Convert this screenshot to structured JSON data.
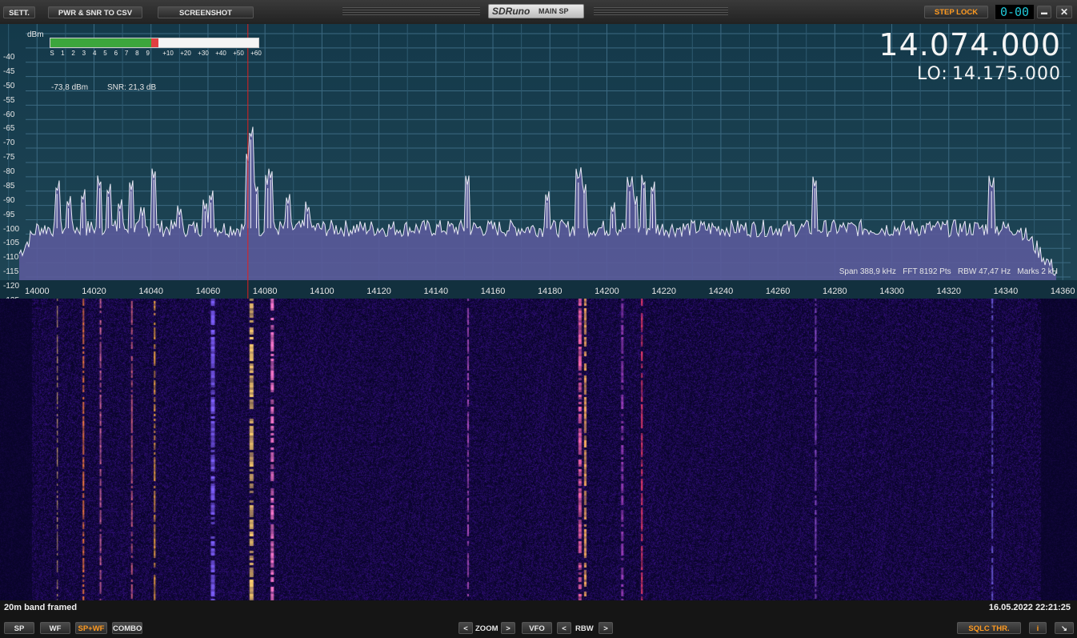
{
  "title_bar": {
    "sett_label": "SETT.",
    "pwr_snr_label": "PWR & SNR TO CSV",
    "screenshot_label": "SCREENSHOT",
    "logo_text": "SDRuno",
    "logo_sub": "MAIN SP",
    "step_lock_label": "STEP LOCK",
    "channel_display": "0-00",
    "minimize_glyph": "▬",
    "close_glyph": "✕"
  },
  "spectrum": {
    "dbm_unit": "dBm",
    "smeter_labels": [
      "S",
      "1",
      "2",
      "3",
      "4",
      "5",
      "6",
      "7",
      "8",
      "9",
      "+10",
      "+20",
      "+30",
      "+40",
      "+50",
      "+60"
    ],
    "smeter_fill_fraction": 0.52,
    "power_reading": "-73,8 dBm",
    "snr_reading": "SNR: 21,3 dB",
    "frequency": "14.074.000",
    "lo_label": "LO:",
    "lo_frequency": "14.175.000",
    "info_line": "Span 388,9 kHz   FFT 8192 Pts   RBW 47,47 Hz   Marks 2 kH"
  },
  "chart_data": {
    "type": "line",
    "xlim": [
      13987,
      14365
    ],
    "ylim": [
      -125,
      -40
    ],
    "yticks": [
      "-40",
      "-45",
      "-50",
      "-55",
      "-60",
      "-65",
      "-70",
      "-75",
      "-80",
      "-85",
      "-90",
      "-95",
      "-100",
      "-105",
      "-110",
      "-115",
      "-120",
      "-125"
    ],
    "xticks": [
      "14000",
      "14020",
      "14040",
      "14060",
      "14080",
      "14100",
      "14120",
      "14140",
      "14160",
      "14180",
      "14200",
      "14220",
      "14240",
      "14260",
      "14280",
      "14300",
      "14320",
      "14340",
      "14360"
    ],
    "noise_floor": -108,
    "tuned_marker": 14074,
    "peaks": [
      {
        "x": 14007,
        "y": -96
      },
      {
        "x": 14011,
        "y": -101
      },
      {
        "x": 14016,
        "y": -99
      },
      {
        "x": 14022,
        "y": -94
      },
      {
        "x": 14025,
        "y": -97
      },
      {
        "x": 14029,
        "y": -102
      },
      {
        "x": 14033,
        "y": -95
      },
      {
        "x": 14037,
        "y": -104
      },
      {
        "x": 14041,
        "y": -91
      },
      {
        "x": 14050,
        "y": -104
      },
      {
        "x": 14059,
        "y": -102
      },
      {
        "x": 14061,
        "y": -99
      },
      {
        "x": 14074,
        "y": -85
      },
      {
        "x": 14075,
        "y": -77
      },
      {
        "x": 14077,
        "y": -96
      },
      {
        "x": 14081,
        "y": -94
      },
      {
        "x": 14082,
        "y": -91
      },
      {
        "x": 14088,
        "y": -100
      },
      {
        "x": 14095,
        "y": -103
      },
      {
        "x": 14151,
        "y": -93
      },
      {
        "x": 14179,
        "y": -99
      },
      {
        "x": 14190,
        "y": -92
      },
      {
        "x": 14192,
        "y": -96
      },
      {
        "x": 14202,
        "y": -103
      },
      {
        "x": 14208,
        "y": -95
      },
      {
        "x": 14210,
        "y": -100
      },
      {
        "x": 14213,
        "y": -94
      },
      {
        "x": 14216,
        "y": -96
      },
      {
        "x": 14273,
        "y": -94
      },
      {
        "x": 14335,
        "y": -95
      }
    ]
  },
  "waterfall": {
    "caption": "20m band framed",
    "timestamp": "16.05.2022 22:21:25"
  },
  "bottom_bar": {
    "sp_label": "SP",
    "wf_label": "WF",
    "spwf_label": "SP+WF",
    "combo_label": "COMBO",
    "zoom_label": "ZOOM",
    "vfo_label": "VFO",
    "rbw_label": "RBW",
    "left_glyph": "<",
    "right_glyph": ">",
    "sqlc_label": "SQLC THR.",
    "info_glyph": "i",
    "resize_glyph": "↘"
  },
  "colors": {
    "accent_orange": "#ff9a20",
    "spectrum_fill": "#5a5a9a",
    "marker_red": "#e02020",
    "smeter_green": "#3ca63c",
    "smeter_red": "#e04040"
  }
}
